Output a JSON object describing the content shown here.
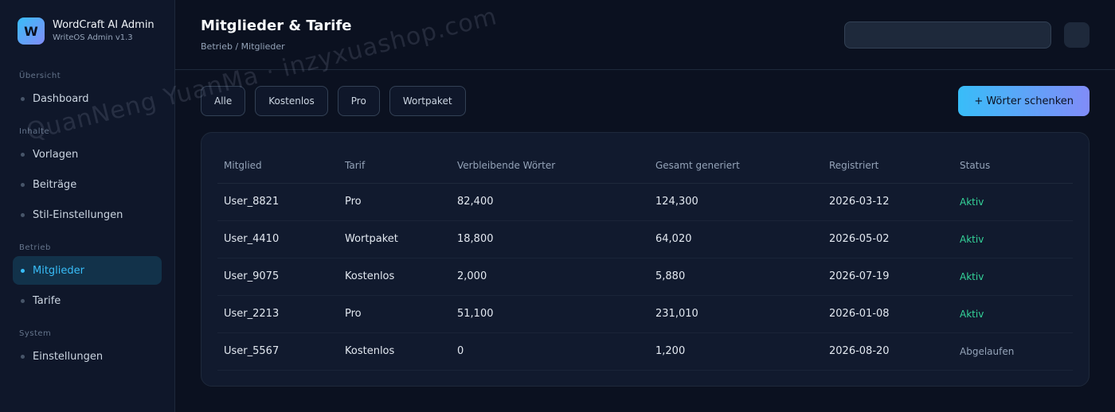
{
  "brand": {
    "logo_letter": "W",
    "name": "WordCraft AI Admin",
    "subtitle": "WriteOS Admin v1.3"
  },
  "sidebar": {
    "groups": [
      {
        "title": "Übersicht",
        "items": [
          {
            "label": "Dashboard",
            "active": false
          }
        ]
      },
      {
        "title": "Inhalte",
        "items": [
          {
            "label": "Vorlagen",
            "active": false
          },
          {
            "label": "Beiträge",
            "active": false
          },
          {
            "label": "Stil-Einstellungen",
            "active": false
          }
        ]
      },
      {
        "title": "Betrieb",
        "items": [
          {
            "label": "Mitglieder",
            "active": true
          },
          {
            "label": "Tarife",
            "active": false
          }
        ]
      },
      {
        "title": "System",
        "items": [
          {
            "label": "Einstellungen",
            "active": false
          }
        ]
      }
    ]
  },
  "header": {
    "title": "Mitglieder & Tarife",
    "breadcrumb": "Betrieb / Mitglieder",
    "search_value": ""
  },
  "filters": [
    "Alle",
    "Kostenlos",
    "Pro",
    "Wortpaket"
  ],
  "primary_action": "+ Wörter schenken",
  "table": {
    "columns": [
      "Mitglied",
      "Tarif",
      "Verbleibende Wörter",
      "Gesamt generiert",
      "Registriert",
      "Status"
    ],
    "rows": [
      [
        "User_8821",
        "Pro",
        "82,400",
        "124,300",
        "2026-03-12",
        "Aktiv"
      ],
      [
        "User_4410",
        "Wortpaket",
        "18,800",
        "64,020",
        "2026-05-02",
        "Aktiv"
      ],
      [
        "User_9075",
        "Kostenlos",
        "2,000",
        "5,880",
        "2026-07-19",
        "Aktiv"
      ],
      [
        "User_2213",
        "Pro",
        "51,100",
        "231,010",
        "2026-01-08",
        "Aktiv"
      ],
      [
        "User_5567",
        "Kostenlos",
        "0",
        "1,200",
        "2026-08-20",
        "Abgelaufen"
      ]
    ]
  },
  "watermark": "QuanNeng YuanMa · inzyxuashop.com",
  "colors": {
    "accent": "#38bdf8",
    "accent2": "#818cf8",
    "active_status": "#34d399",
    "background": "#0b1120"
  }
}
